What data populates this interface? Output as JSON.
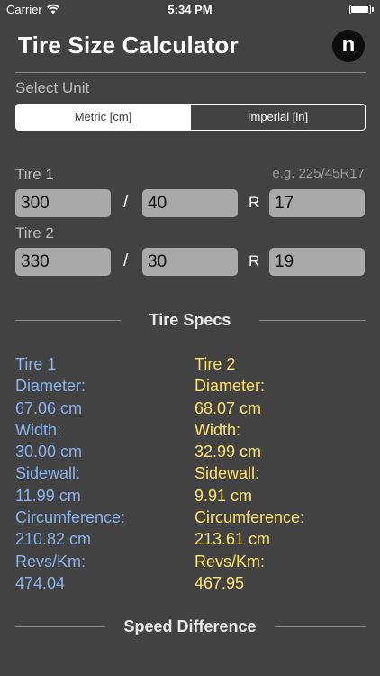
{
  "status_bar": {
    "carrier": "Carrier",
    "time": "5:34 PM"
  },
  "header": {
    "title": "Tire Size Calculator",
    "logo_letter": "n"
  },
  "unit": {
    "label": "Select Unit",
    "options": [
      "Metric [cm]",
      "Imperial [in]"
    ],
    "selected": "Metric [cm]"
  },
  "tire1_input": {
    "label": "Tire 1",
    "example": "e.g. 225/45R17",
    "width": "300",
    "aspect": "40",
    "rim": "17"
  },
  "tire2_input": {
    "label": "Tire 2",
    "width": "330",
    "aspect": "30",
    "rim": "19"
  },
  "separators": {
    "slash": "/",
    "r": "R"
  },
  "specs": {
    "title": "Tire Specs",
    "tire1": {
      "name": "Tire 1",
      "diameter_label": "Diameter:",
      "diameter": "67.06 cm",
      "width_label": "Width:",
      "width": "30.00 cm",
      "sidewall_label": "Sidewall:",
      "sidewall": "11.99 cm",
      "circumference_label": "Circumference:",
      "circumference": "210.82 cm",
      "revs_label": "Revs/Km:",
      "revs": "474.04"
    },
    "tire2": {
      "name": "Tire 2",
      "diameter_label": "Diameter:",
      "diameter": "68.07 cm",
      "width_label": "Width:",
      "width": "32.99 cm",
      "sidewall_label": "Sidewall:",
      "sidewall": "9.91 cm",
      "circumference_label": "Circumference:",
      "circumference": "213.61 cm",
      "revs_label": "Revs/Km:",
      "revs": "467.95"
    }
  },
  "speed": {
    "title": "Speed Difference"
  },
  "colors": {
    "background": "#424242",
    "tire1": "#8ab4f0",
    "tire2": "#ffe36b",
    "field": "#a9a9a9"
  }
}
